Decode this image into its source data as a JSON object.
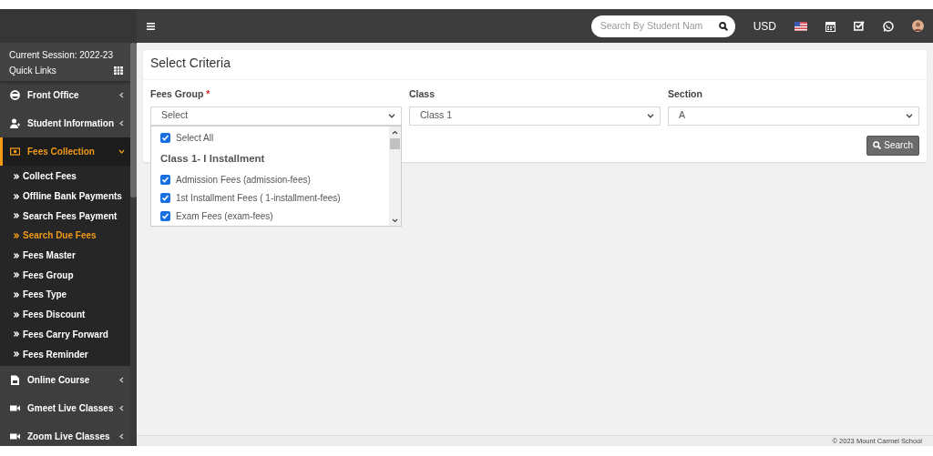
{
  "header": {
    "search": {
      "placeholder": "Search By Student Nam"
    },
    "currency": "USD"
  },
  "sidebar": {
    "session": "Current Session: 2022-23",
    "quick_links": "Quick Links",
    "items": [
      {
        "label": "Front Office",
        "expanded": false,
        "selected": false
      },
      {
        "label": "Student Information",
        "expanded": false,
        "selected": false
      },
      {
        "label": "Fees Collection",
        "expanded": true,
        "selected": true,
        "children": [
          {
            "label": "Collect Fees",
            "selected": false
          },
          {
            "label": "Offline Bank Payments",
            "selected": false
          },
          {
            "label": "Search Fees Payment",
            "selected": false
          },
          {
            "label": "Search Due Fees",
            "selected": true
          },
          {
            "label": "Fees Master",
            "selected": false
          },
          {
            "label": "Fees Group",
            "selected": false
          },
          {
            "label": "Fees Type",
            "selected": false
          },
          {
            "label": "Fees Discount",
            "selected": false
          },
          {
            "label": "Fees Carry Forward",
            "selected": false
          },
          {
            "label": "Fees Reminder",
            "selected": false
          }
        ]
      },
      {
        "label": "Online Course",
        "expanded": false,
        "selected": false
      },
      {
        "label": "Gmeet Live Classes",
        "expanded": false,
        "selected": false
      },
      {
        "label": "Zoom Live Classes",
        "expanded": false,
        "selected": false
      }
    ]
  },
  "card": {
    "title": "Select Criteria",
    "fees_group": {
      "label": "Fees Group",
      "required_mark": "*",
      "value": "Select",
      "select_all": {
        "label": "Select All",
        "checked": true
      },
      "groups": [
        {
          "label": "Class 1- I Installment",
          "items": [
            {
              "label": "Admission Fees (admission-fees)",
              "checked": true
            },
            {
              "label": "1st Installment Fees ( 1-installment-fees)",
              "checked": true
            },
            {
              "label": "Exam Fees (exam-fees)",
              "checked": true
            }
          ]
        }
      ]
    },
    "class": {
      "label": "Class",
      "value": "Class 1"
    },
    "section": {
      "label": "Section",
      "value": "A"
    },
    "button": "Search"
  },
  "footer": "© 2023 Mount Carmel School"
}
